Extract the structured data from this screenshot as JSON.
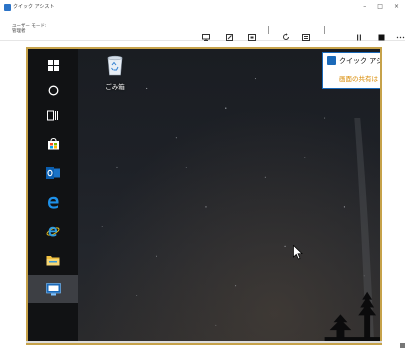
{
  "window": {
    "title": "クイック アシスト",
    "controls": {
      "minimize": "–",
      "maximize": "□",
      "close": "×"
    }
  },
  "toolbar": {
    "user_mode_line1": "ユーザー モード:",
    "user_mode_line2": "管理者"
  },
  "remote": {
    "recycle_bin_label": "ごみ箱",
    "quick_assist_title": "クイック アシス",
    "quick_assist_text": "画面の共有は"
  },
  "colors": {
    "accent": "#2b73c7",
    "frame": "#c6a24a",
    "notice": "#d98a00"
  }
}
